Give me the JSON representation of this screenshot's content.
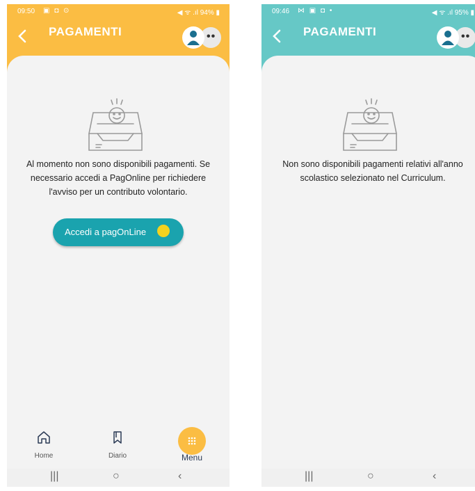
{
  "left": {
    "status": {
      "time": "09:50",
      "icons": "▣ ◘ ⊙",
      "right": "◀ ᯤ .ıl 94% ▮"
    },
    "header": {
      "title": "PAGAMENTI",
      "header_color": "#fbbd43"
    },
    "message": "Al momento non sono disponibili pagamenti. Se necessario accedi a PagOnline per richiedere l'avviso per un contributo volontario.",
    "button_label": "Accedi a pagOnLine",
    "nav": {
      "home": "Home",
      "diario": "Diario",
      "menu": "Menu"
    },
    "sys": {
      "recent": "|||",
      "home": "○",
      "back": "‹"
    }
  },
  "right": {
    "status": {
      "time": "09:46",
      "icons": "⋈ ▣ ◘  •",
      "right": "◀ ᯤ .ıl 95% ▮"
    },
    "header": {
      "title": "PAGAMENTI",
      "header_color": "#66c8c6"
    },
    "message": "Non sono disponibili pagamenti relativi all'anno scolastico selezionato nel Curriculum.",
    "sys": {
      "recent": "|||",
      "home": "○",
      "back": "‹"
    }
  },
  "colors": {
    "accent_teal": "#1aa3ae",
    "menu_orange": "#fbbd43"
  },
  "icons": [
    "chevron-left-icon",
    "user-avatar-icon",
    "more-dots-icon",
    "empty-inbox-icon",
    "home-icon",
    "bookmark-icon",
    "grid-menu-icon"
  ]
}
